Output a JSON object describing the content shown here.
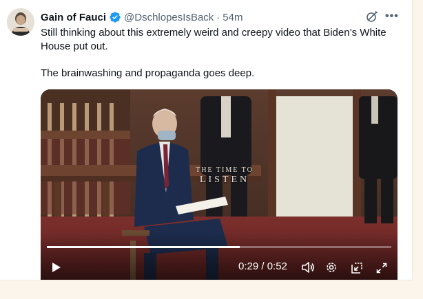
{
  "tweet": {
    "display_name": "Gain of Fauci",
    "handle": "@DschlopesIsBack",
    "separator": "·",
    "time": "54m",
    "text_paragraphs": [
      "Still thinking about this extremely weird and creepy video that Biden’s White House put out.",
      "The brainwashing and propaganda goes deep."
    ]
  },
  "video": {
    "overlay_line1": "THE TIME TO",
    "overlay_line2": "LISTEN",
    "current_time": "0:29",
    "duration": "0:52",
    "time_display": "0:29 / 0:52",
    "progress_fraction": 0.56
  },
  "icons": {
    "verified": "verified-badge-icon",
    "grok": "grok-icon",
    "more": "more-icon",
    "play": "play-icon",
    "volume": "volume-icon",
    "settings": "settings-icon",
    "dock": "dock-icon",
    "fullscreen": "fullscreen-icon"
  },
  "colors": {
    "verified_blue": "#1d9bf0",
    "secondary_text": "#536471",
    "primary_text": "#0f1419",
    "page_background": "#fbf5ec"
  }
}
